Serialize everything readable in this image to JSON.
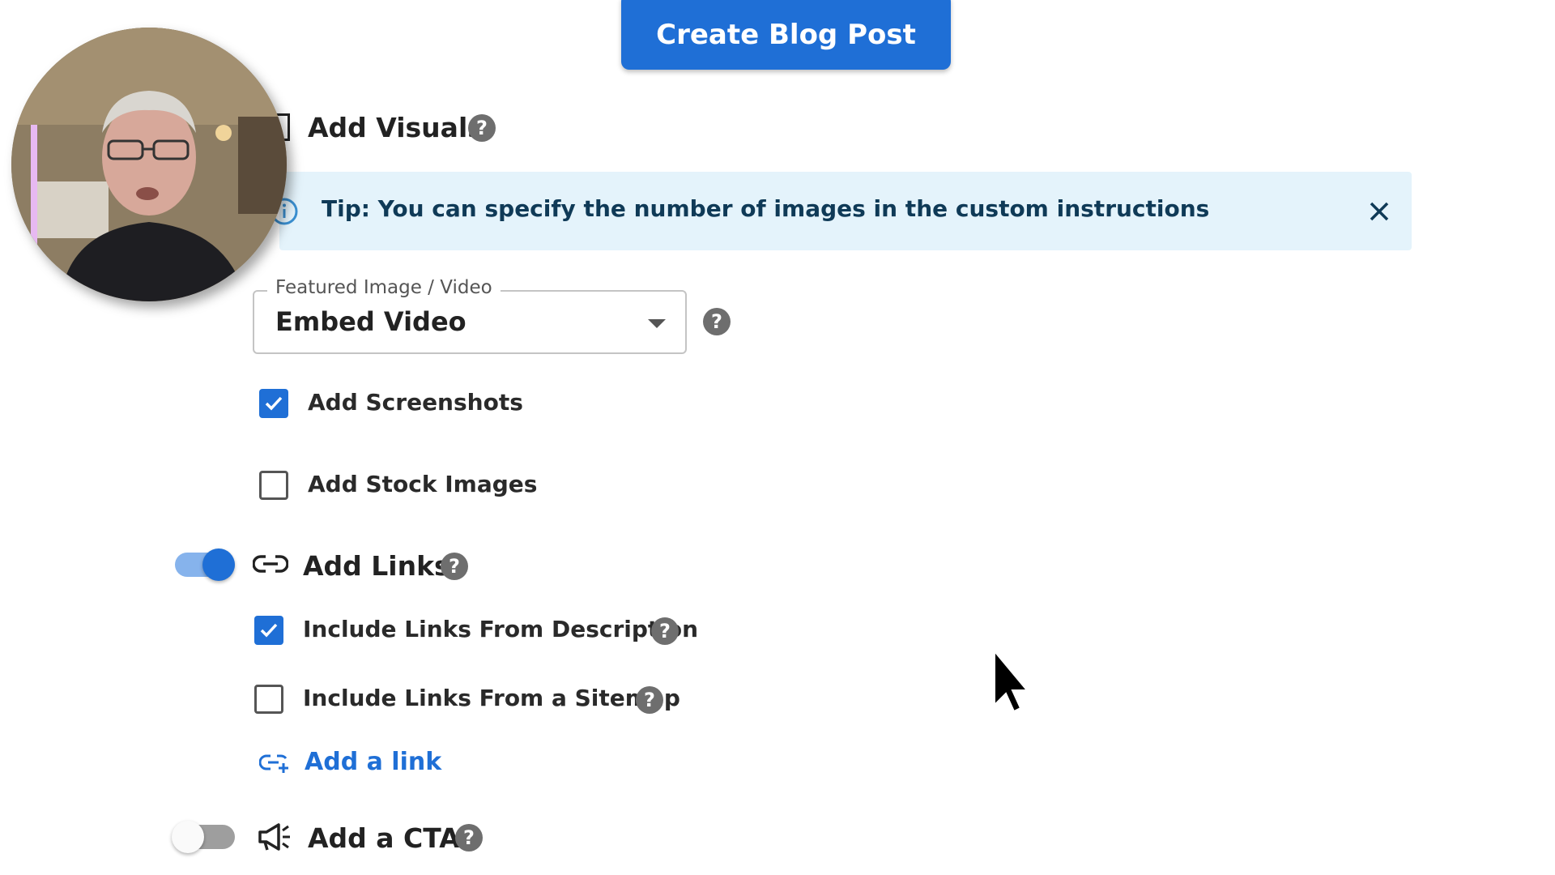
{
  "header": {
    "create_button_label": "Create Blog Post"
  },
  "visuals": {
    "title": "Add Visuals",
    "tip_text": "Tip: You can specify the number of images in the custom instructions",
    "featured": {
      "legend": "Featured Image / Video",
      "value": "Embed Video"
    },
    "options": [
      {
        "label": "Add Screenshots",
        "checked": true
      },
      {
        "label": "Add Stock Images",
        "checked": false
      }
    ]
  },
  "links": {
    "title": "Add Links",
    "enabled": true,
    "options": [
      {
        "label": "Include Links From Description",
        "checked": true
      },
      {
        "label": "Include Links From a Sitemap",
        "checked": false
      }
    ],
    "add_link_label": "Add a link"
  },
  "cta": {
    "title": "Add a CTA",
    "enabled": false
  },
  "icons": {
    "help": "help-circle-icon",
    "info": "info-icon",
    "close": "close-icon",
    "link": "link-icon",
    "add_link": "add-link-icon",
    "megaphone": "megaphone-icon"
  },
  "help_glyph": "?",
  "colors": {
    "accent": "#1f6fd6",
    "tip_bg": "#e4f3fb",
    "help": "#6e6e6e"
  }
}
